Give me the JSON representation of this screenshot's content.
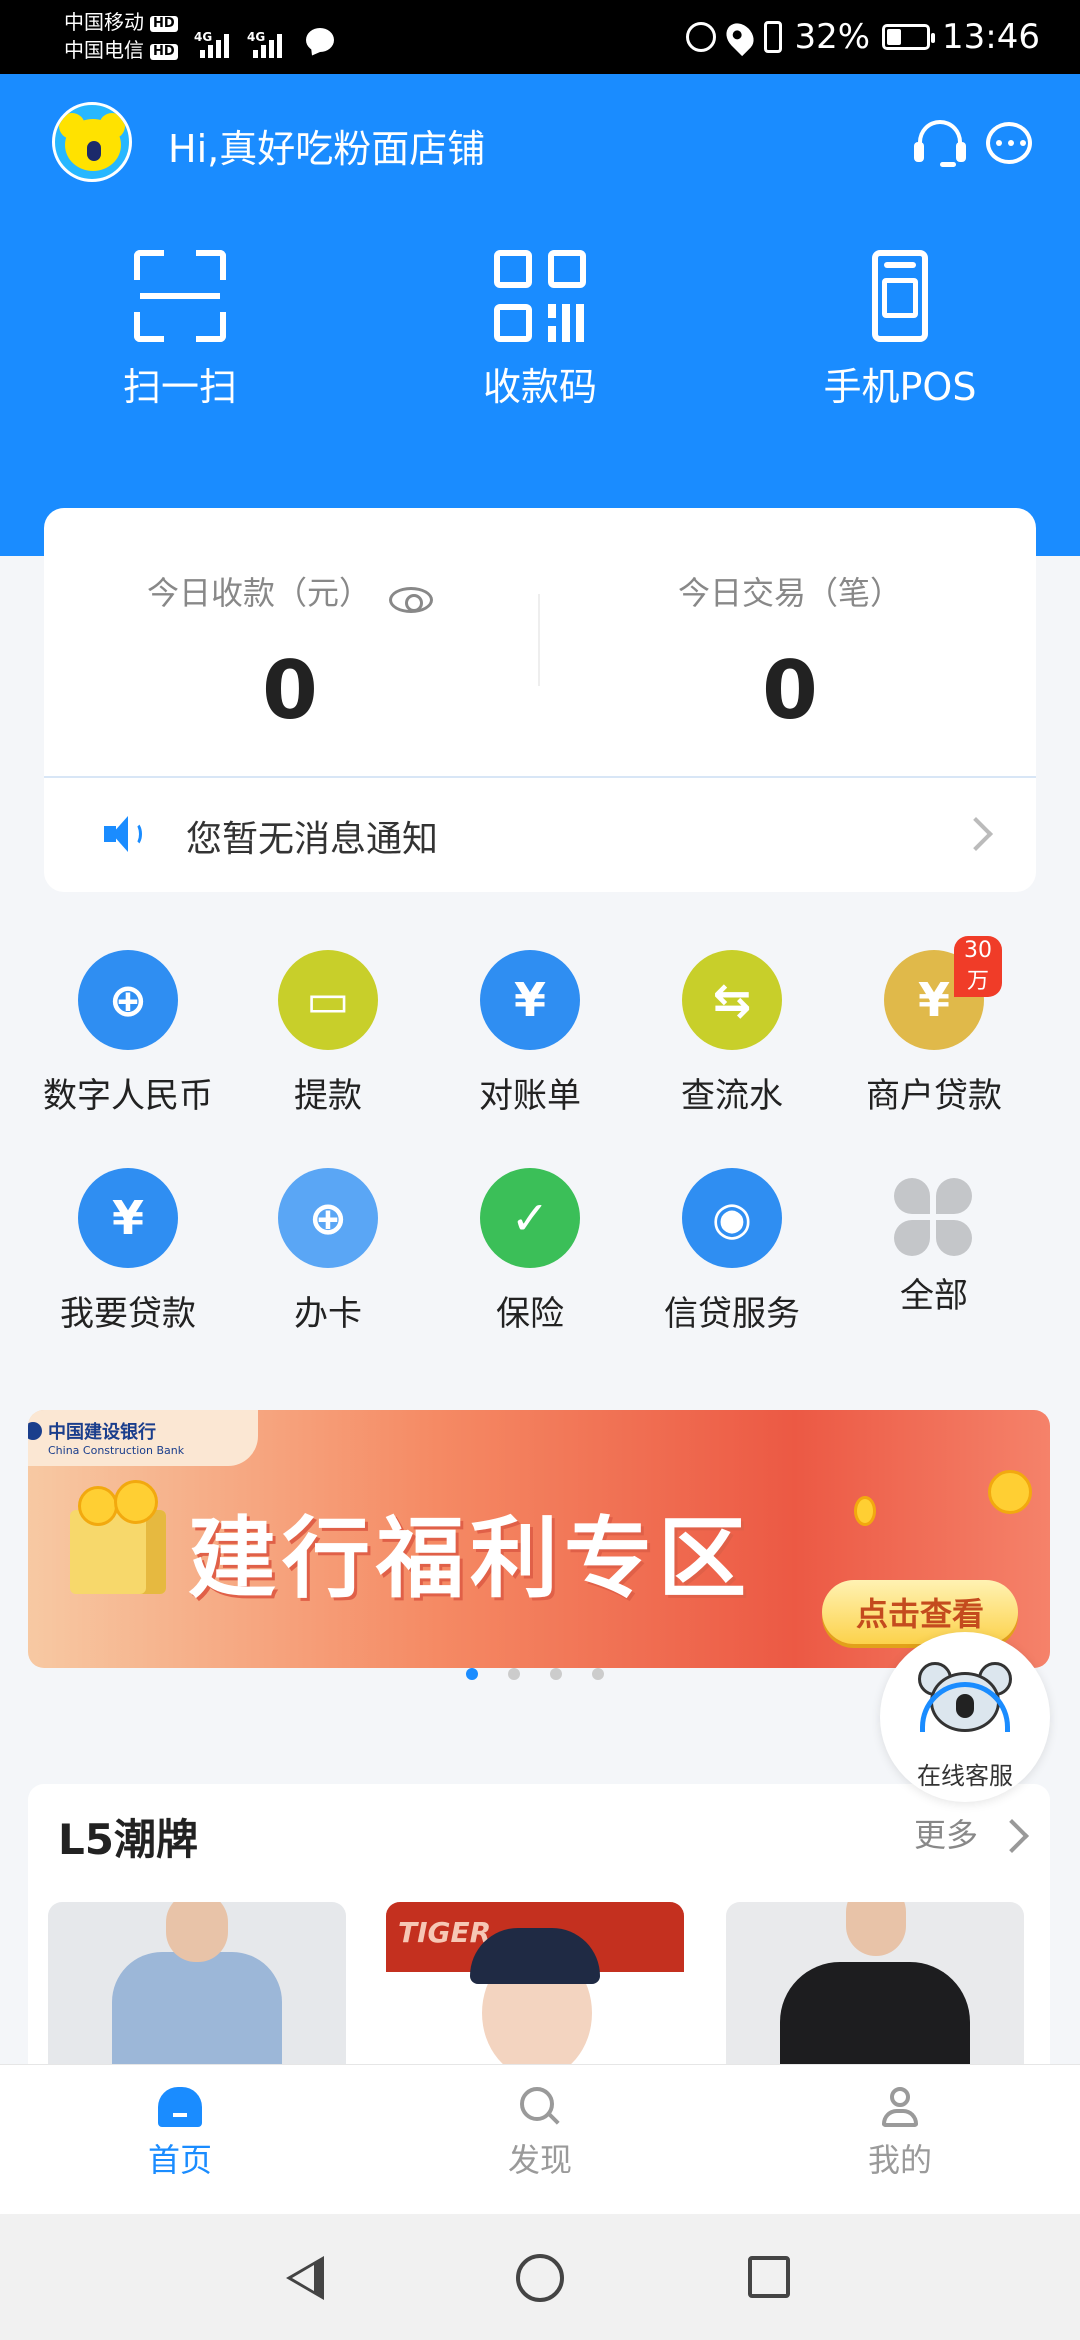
{
  "status_bar": {
    "carrier1": "中国移动",
    "carrier2": "中国电信",
    "hd": "HD",
    "net1": "4G",
    "net2": "4G",
    "battery": "32%",
    "time": "13:46"
  },
  "header": {
    "greeting": "Hi,真好吃粉面店铺",
    "quick_actions": [
      {
        "label": "扫一扫",
        "icon": "scan-icon"
      },
      {
        "label": "收款码",
        "icon": "qr-code-icon"
      },
      {
        "label": "手机POS",
        "icon": "pos-icon"
      }
    ]
  },
  "stats": {
    "today_income_label": "今日收款（元）",
    "today_income_value": "0",
    "today_trans_label": "今日交易（笔）",
    "today_trans_value": "0"
  },
  "notice": {
    "text": "您暂无消息通知"
  },
  "services": [
    {
      "label": "数字人民币",
      "icon": "digital-rmb-icon",
      "color": "#2f8ef2",
      "symbol": "⊕"
    },
    {
      "label": "提款",
      "icon": "wallet-icon",
      "color": "#c8cf2a",
      "symbol": "▭"
    },
    {
      "label": "对账单",
      "icon": "statement-icon",
      "color": "#2f8ef2",
      "symbol": "¥"
    },
    {
      "label": "查流水",
      "icon": "transfer-icon",
      "color": "#c8cf2a",
      "symbol": "⇆"
    },
    {
      "label": "商户贷款",
      "icon": "money-bag-icon",
      "color": "#e0b94a",
      "symbol": "¥",
      "badge": "30万"
    },
    {
      "label": "我要贷款",
      "icon": "loan-hand-icon",
      "color": "#2f8ef2",
      "symbol": "¥"
    },
    {
      "label": "办卡",
      "icon": "card-icon",
      "color": "#5aa6f5",
      "symbol": "⊕"
    },
    {
      "label": "保险",
      "icon": "shield-icon",
      "color": "#3bbf58",
      "symbol": "✓"
    },
    {
      "label": "信贷服务",
      "icon": "credit-bag-icon",
      "color": "#2f8ef2",
      "symbol": "◉"
    },
    {
      "label": "全部",
      "icon": "all-apps-icon",
      "color": "",
      "symbol": ""
    }
  ],
  "banner": {
    "bank_cn": "中国建设银行",
    "bank_en": "China Construction Bank",
    "title": "建行福利专区",
    "button": "点击查看",
    "slide_count": 4,
    "active_slide": 0
  },
  "float_service": {
    "label": "在线客服"
  },
  "l5_section": {
    "title": "L5潮牌",
    "more": "更多",
    "product2_brand": "TIGER"
  },
  "bottom_nav": [
    {
      "label": "首页",
      "active": true
    },
    {
      "label": "发现",
      "active": false
    },
    {
      "label": "我的",
      "active": false
    }
  ],
  "colors": {
    "brand_blue": "#1a8cff",
    "badge_red": "#f03c28"
  }
}
